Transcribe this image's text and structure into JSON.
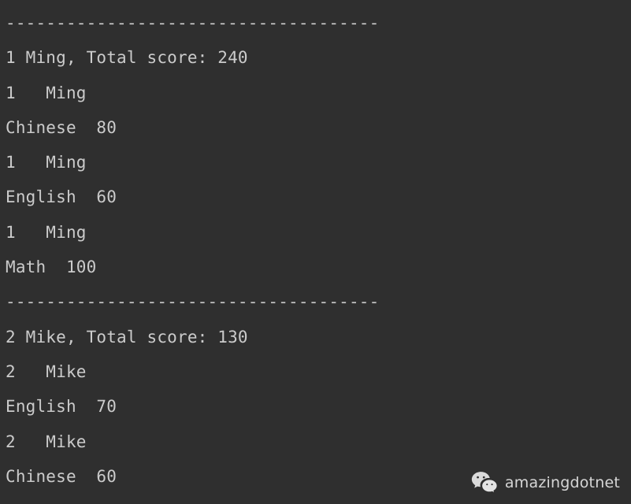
{
  "window": {
    "type": "console-output",
    "background_color": "#2f2f2f",
    "text_color": "#cbcbcb"
  },
  "console": {
    "lines": [
      "-------------------------------------",
      "1 Ming, Total score: 240",
      "1   Ming",
      "Chinese  80",
      "1   Ming",
      "English  60",
      "1   Ming",
      "Math  100",
      "-------------------------------------",
      "2 Mike, Total score: 130",
      "2   Mike",
      "English  70",
      "2   Mike",
      "Chinese  60"
    ],
    "records": [
      {
        "id": "1",
        "name": "Ming",
        "total_score": "240",
        "subjects": [
          {
            "subject": "Chinese",
            "score": "80"
          },
          {
            "subject": "English",
            "score": "60"
          },
          {
            "subject": "Math",
            "score": "100"
          }
        ]
      },
      {
        "id": "2",
        "name": "Mike",
        "total_score": "130",
        "subjects": [
          {
            "subject": "English",
            "score": "70"
          },
          {
            "subject": "Chinese",
            "score": "60"
          }
        ]
      }
    ]
  },
  "watermark": {
    "icon": "wechat-icon",
    "label": "amazingdotnet",
    "color": "#e2e2e2"
  }
}
